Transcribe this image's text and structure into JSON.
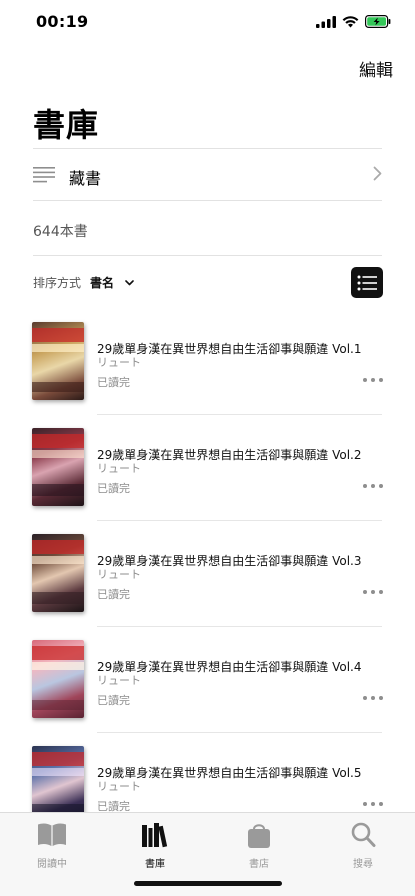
{
  "status_bar": {
    "time": "00:19"
  },
  "header": {
    "edit_label": "編輯",
    "title": "書庫"
  },
  "collections": {
    "label": "藏書"
  },
  "book_count": "644本書",
  "sort": {
    "label": "排序方式",
    "value": "書名"
  },
  "books": [
    {
      "title": "29歲單身漢在異世界想自由生活卻事與願違 Vol.1",
      "author": "リュート",
      "status": "已讀完"
    },
    {
      "title": "29歲單身漢在異世界想自由生活卻事與願違 Vol.2",
      "author": "リュート",
      "status": "已讀完"
    },
    {
      "title": "29歲單身漢在異世界想自由生活卻事與願違 Vol.3",
      "author": "リュート",
      "status": "已讀完"
    },
    {
      "title": "29歲單身漢在異世界想自由生活卻事與願違 Vol.4",
      "author": "リュート",
      "status": "已讀完"
    },
    {
      "title": "29歲單身漢在異世界想自由生活卻事與願違 Vol.5",
      "author": "リュート",
      "status": "已讀完"
    }
  ],
  "tab_bar": {
    "tabs": [
      {
        "label": "閱讀中",
        "icon": "book-open-icon",
        "active": false
      },
      {
        "label": "書庫",
        "icon": "library-icon",
        "active": true
      },
      {
        "label": "書店",
        "icon": "shopping-bag-icon",
        "active": false
      },
      {
        "label": "搜尋",
        "icon": "search-icon",
        "active": false
      }
    ]
  },
  "colors": {
    "accent": "#111111",
    "secondary_text": "#8e8e8e",
    "battery": "#34c759"
  }
}
